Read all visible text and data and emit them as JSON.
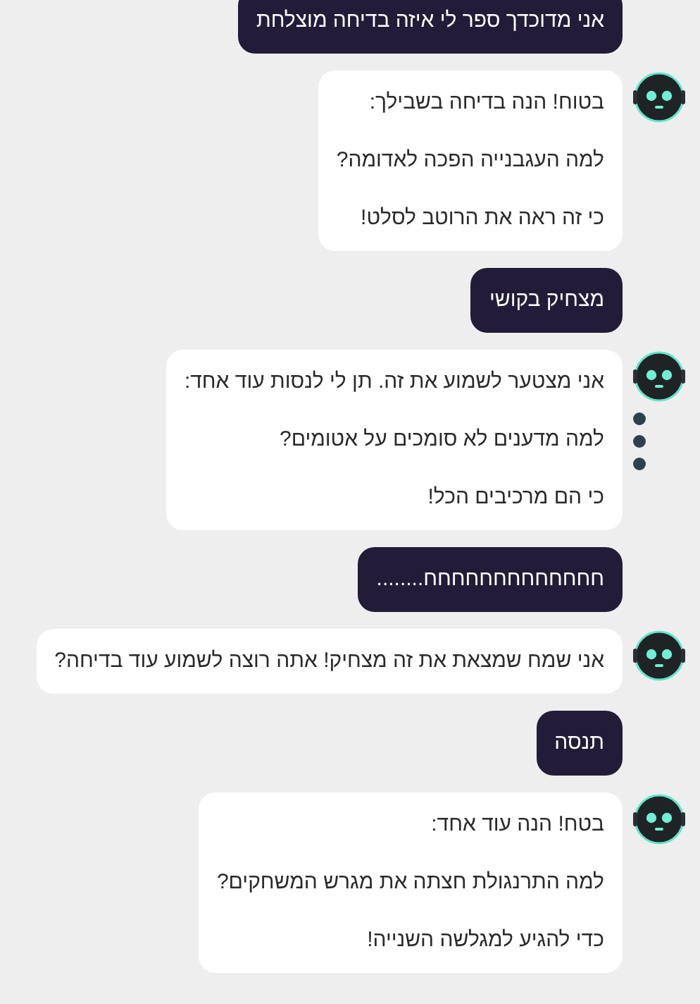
{
  "messages": [
    {
      "kind": "user",
      "paragraphs": [
        "אני מדוכדך ספר לי איזה בדיחה מוצלחת"
      ]
    },
    {
      "kind": "bot",
      "menu": false,
      "paragraphs": [
        "בטוח! הנה בדיחה בשבילך:",
        "למה העגבנייה הפכה לאדומה?",
        "כי זה ראה את הרוטב לסלט!"
      ]
    },
    {
      "kind": "user",
      "paragraphs": [
        "מצחיק בקושי"
      ]
    },
    {
      "kind": "bot",
      "menu": true,
      "paragraphs": [
        "אני מצטער לשמוע את זה. תן לי לנסות עוד אחד:",
        "למה מדענים לא סומכים על אטומים?",
        "כי הם מרכיבים הכל!"
      ]
    },
    {
      "kind": "user",
      "paragraphs": [
        "חחחחחחחחחחחחח........"
      ]
    },
    {
      "kind": "bot",
      "menu": false,
      "paragraphs": [
        "אני שמח שמצאת את זה מצחיק! אתה רוצה לשמוע עוד בדיחה?"
      ]
    },
    {
      "kind": "user",
      "paragraphs": [
        "תנסה"
      ]
    },
    {
      "kind": "bot",
      "menu": false,
      "paragraphs": [
        "בטח! הנה עוד אחד:",
        "למה התרנגולת חצתה את מגרש המשחקים?",
        "כדי להגיע למגלשה השנייה!"
      ]
    }
  ]
}
